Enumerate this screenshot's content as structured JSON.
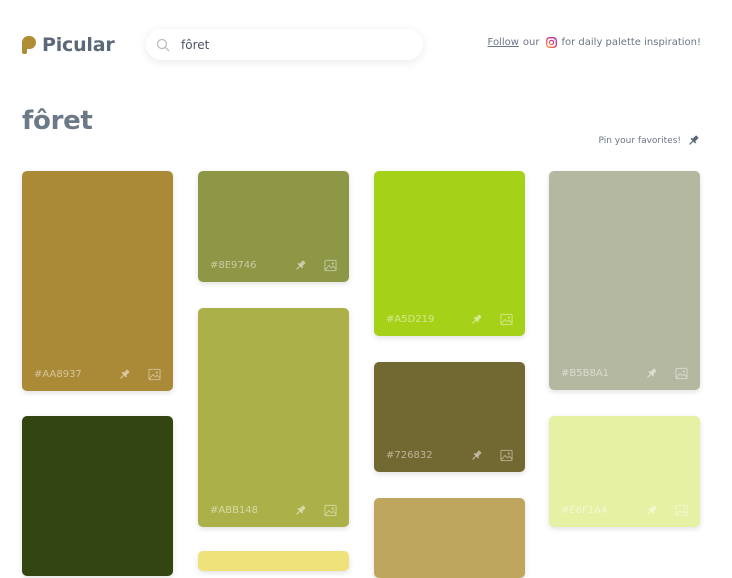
{
  "brand": {
    "name": "Picular",
    "color": "#b08c35"
  },
  "search": {
    "value": "fôret"
  },
  "follow": {
    "link": "Follow",
    "our": "our",
    "tail": "for daily palette inspiration!"
  },
  "page": {
    "title": "fôret",
    "pin_hint": "Pin your favorites!"
  },
  "swatches": [
    {
      "hex": "#AA8937",
      "color": "#aa8937",
      "hex_visible": true
    },
    {
      "hex": "#8E9746",
      "color": "#8e9746",
      "hex_visible": true
    },
    {
      "hex": "#A5D219",
      "color": "#a5d219",
      "hex_visible": true
    },
    {
      "hex": "#B5B8A1",
      "color": "#b5b8a1",
      "hex_visible": true
    },
    {
      "hex": "",
      "color": "#334612",
      "hex_visible": false
    },
    {
      "hex": "#ABB148",
      "color": "#abb148",
      "hex_visible": true
    },
    {
      "hex": "#726832",
      "color": "#726832",
      "hex_visible": true
    },
    {
      "hex": "#E6F1A4",
      "color": "#e6f1a4",
      "hex_visible": true
    },
    {
      "hex": "",
      "color": "#f0e27a",
      "hex_visible": false
    },
    {
      "hex": "",
      "color": "#bea65f",
      "hex_visible": false
    }
  ],
  "icons": {
    "pin": "pin-icon",
    "image": "image-icon",
    "search": "search-icon",
    "instagram": "instagram-icon"
  }
}
